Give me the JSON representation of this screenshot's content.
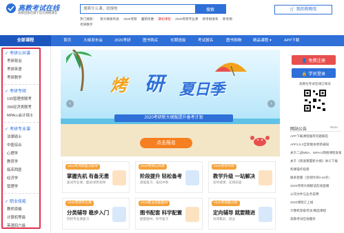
{
  "header": {
    "logo_text": "高教考试在线",
    "logo_sub": "高教出版社旗下官方网络课堂",
    "search_placeholder": "搜索什么课，就搜啥",
    "search_button": "搜索",
    "hot_label": "热门搜索：",
    "hot_links": [
      "新大纲发布会",
      "2020考研",
      "暑研优惠",
      "期初课程",
      "2020考研专业课",
      "新考纲发布",
      "新考纲",
      "考研数学"
    ],
    "cart_label": "我的购物车"
  },
  "nav": {
    "all_courses": "全部课程",
    "items": [
      "首页",
      "大纲发布会",
      "2020考研",
      "图书购买",
      "长期班级",
      "考试报名",
      "图书购物",
      "精品课程 ▾",
      "APP下载"
    ]
  },
  "sidebar": {
    "categories": [
      {
        "title": "考研公共课",
        "items": [
          "考研政治",
          "考研英语",
          "考研数学"
        ]
      },
      {
        "title": "考研专硕",
        "items": [
          "199管理类联考",
          "396经济类联考",
          "MPAcc会计硕士"
        ]
      },
      {
        "title": "考研专业课",
        "items": [
          "法律硕士",
          "中医综合",
          "心理学",
          "教育学",
          "临床西医",
          "经济学",
          "管理学"
        ]
      },
      {
        "title": "职业技能",
        "items": [
          "教师资格",
          "计算机等级",
          "英语四六级"
        ]
      }
    ]
  },
  "banner": {
    "title_a": "烤",
    "title_b": "研",
    "title_c": "夏日季",
    "ribbon": "2020考研新大纲版提升备考计划",
    "cta": "点击报名"
  },
  "cards": [
    {
      "tag": "2019年考研复试指导",
      "title": "掌握先机 有备无患",
      "sub": "复试专业课、面试/调剂指导"
    },
    {
      "tag": "2020考研公共课",
      "title": "阶段提升 轻松备考",
      "sub": "基础复习、强化冲刺"
    },
    {
      "tag": "2020考研专硕",
      "title": "教学升级 一站解决",
      "sub": "名师授课、在线答疑"
    },
    {
      "tag": "2020考研专业课",
      "title": "分类辅导 稳步入门",
      "sub": "院校专业课复习"
    },
    {
      "tag": "2020职业技能图书",
      "title": "图书配套 科学配置",
      "sub": "配套图书、科学复习"
    },
    {
      "tag": "2020考研集训营",
      "title": "定向辅导 就要精进",
      "sub": "封闭集训、就业"
    }
  ],
  "right": {
    "login": "免费注册",
    "register": "学员登录",
    "qr_label": "高教社考试在线订阅号",
    "announcement_title": "网站公告",
    "announcement_more": "More",
    "announcements": [
      "APP下载课程缓存问题解答",
      "APP2.5.0全新版本更新通知",
      "关于二战MBA、MPAcc网络课程安排",
      "关于《快速掌握新大纲》讲义下载",
      "购课操作指南",
      "联系客服（咨询时间9-18点）",
      "2020考研大纲解读在线直播",
      "公司文件与业务说明",
      "2020课程订上线",
      "计算机等级考试-精品课程",
      "高教考试在线服务"
    ]
  },
  "colors": {
    "brand": "#2e6fd8",
    "accent": "#f57f21",
    "highlight": "#e0304a"
  }
}
